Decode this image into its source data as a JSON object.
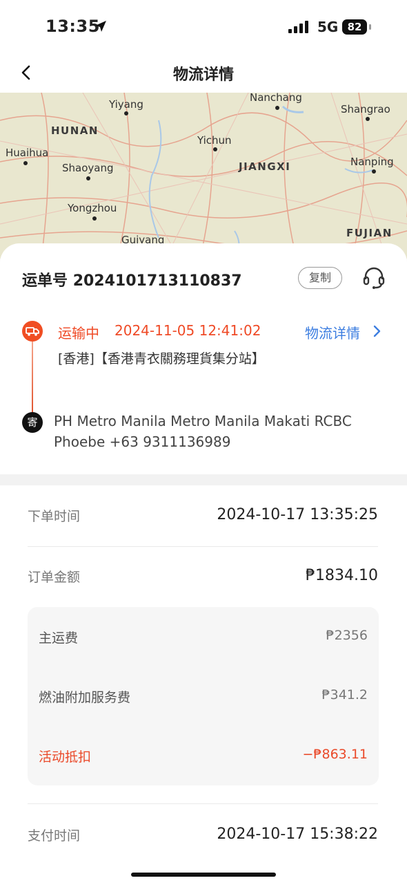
{
  "status_bar": {
    "time": "13:35",
    "network": "5G",
    "battery": "82"
  },
  "header": {
    "title": "物流详情"
  },
  "map": {
    "labels": {
      "yiyang": "Yiyang",
      "nanchang": "Nanchang",
      "shangrao": "Shangrao",
      "hunan": "HUNAN",
      "huaihua": "Huaihua",
      "yichun": "Yichun",
      "shaoyang": "Shaoyang",
      "jiangxi": "JIANGXI",
      "nanping": "Nanping",
      "yongzhou": "Yongzhou",
      "guiyang": "Guiyang",
      "fujian": "FUJIAN"
    }
  },
  "shipment": {
    "waybill_label": "运单号",
    "waybill_number": "2024101713110837",
    "copy_label": "复制",
    "status": "运输中",
    "status_time": "2024-11-05 12:41:02",
    "detail_link": "物流详情",
    "location": "[香港]【香港青衣關務理貨集分站】",
    "sender_badge": "寄",
    "address_line1": "PH Metro Manila Metro Manila Makati RCBC",
    "address_line2": "Phoebe +63 9311136989"
  },
  "order": {
    "order_time_label": "下单时间",
    "order_time": "2024-10-17 13:35:25",
    "amount_label": "订单金额",
    "amount": "₱1834.10",
    "fees": {
      "main_label": "主运费",
      "main_value": "₱2356",
      "fuel_label": "燃油附加服务费",
      "fuel_value": "₱341.2",
      "discount_label": "活动抵扣",
      "discount_value": "−₱863.11"
    },
    "pay_time_label": "支付时间",
    "pay_time": "2024-10-17 15:38:22"
  },
  "colors": {
    "accent_red": "#f04e23",
    "link_blue": "#3d7ee0"
  }
}
